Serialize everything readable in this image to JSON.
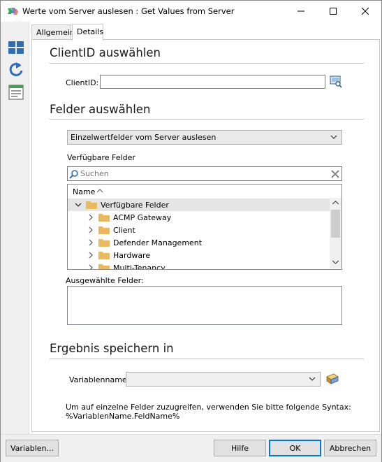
{
  "window": {
    "title": "Werte vom Server auslesen : Get Values from Server",
    "icon": "app-icon"
  },
  "titlebar_buttons": [
    "minimize-icon",
    "maximize-icon",
    "close-icon"
  ],
  "sidebar_icons": [
    "layout-grid-icon",
    "refresh-icon",
    "list-doc-icon"
  ],
  "tabs": [
    {
      "label": "Allgemein",
      "active": false
    },
    {
      "label": "Details",
      "active": true
    }
  ],
  "clientid_section": {
    "title": "ClientID auswählen",
    "field_label": "ClientID:",
    "field_value": ""
  },
  "fields_section": {
    "title": "Felder auswählen",
    "mode_selected": "Einzelwertfelder vom Server auslesen",
    "available_label": "Verfügbare Felder",
    "search_placeholder": "Suchen",
    "column_header": "Name",
    "tree": [
      {
        "label": "Verfügbare Felder",
        "level": 0,
        "expanded": true,
        "selected": true
      },
      {
        "label": "ACMP Gateway",
        "level": 1,
        "expanded": false
      },
      {
        "label": "Client",
        "level": 1,
        "expanded": false
      },
      {
        "label": "Defender Management",
        "level": 1,
        "expanded": false
      },
      {
        "label": "Hardware",
        "level": 1,
        "expanded": false
      },
      {
        "label": "Multi-Tenancy",
        "level": 1,
        "expanded": false
      }
    ],
    "selected_label": "Ausgewählte Felder:"
  },
  "result_section": {
    "title": "Ergebnis speichern in",
    "variable_label": "Variablenname:",
    "variable_value": "",
    "hint_line1": "Um auf einzelne Felder zuzugreifen, verwenden Sie bitte folgende Syntax:",
    "hint_line2": "%VariablenName.FeldName%"
  },
  "footer": {
    "variables_button": "Variablen...",
    "help_button": "Hilfe",
    "ok_button": "OK",
    "cancel_button": "Abbrechen"
  },
  "colors": {
    "accent": "#0078d7",
    "folder": "#e8b960",
    "selected_row": "#e5e5e5"
  }
}
